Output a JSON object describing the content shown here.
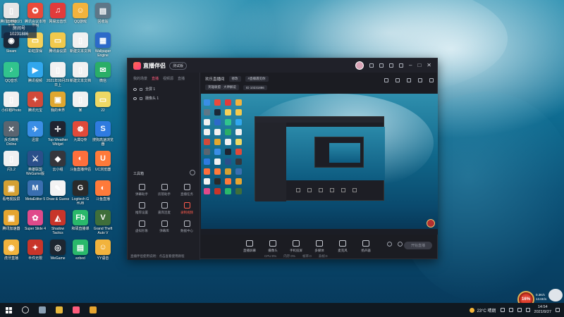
{
  "desktop": {
    "icons": [
      {
        "label": "此电脑",
        "color": "#3a8ee6",
        "glyph": "▣"
      },
      {
        "label": "腾讯会议本地录制",
        "color": "#e94a3a",
        "glyph": "✪"
      },
      {
        "label": "网易云音乐",
        "color": "#e23b3b",
        "glyph": "♫"
      },
      {
        "label": "QQ游戏",
        "color": "#f2b33d",
        "glyph": "☺"
      },
      {
        "label": "回收站",
        "color": "#5e7788",
        "glyph": "▤"
      },
      {
        "label": "Steam",
        "color": "#1b2838",
        "glyph": "◉"
      },
      {
        "label": "彩虹屏保",
        "color": "#f6d15a",
        "glyph": "▭"
      },
      {
        "label": "腾讯会议屏",
        "color": "#f2c94c",
        "glyph": "▭"
      },
      {
        "label": "新建文本文档",
        "color": "#f1f1f1",
        "glyph": "▯"
      },
      {
        "label": "Wallpaper Engine",
        "color": "#2c6ac9",
        "glyph": "▦"
      },
      {
        "label": "QQ音乐",
        "color": "#31c48d",
        "glyph": "♪"
      },
      {
        "label": "腾讯视频",
        "color": "#31a7ee",
        "glyph": "▶"
      },
      {
        "label": "2021年09月29日上",
        "color": "#f1f1f1",
        "glyph": "▯"
      },
      {
        "label": "新建文本文档",
        "color": "#f1f1f1",
        "glyph": "▯"
      },
      {
        "label": "微信",
        "color": "#2aae67",
        "glyph": "✉"
      },
      {
        "label": "小红帽Photo",
        "color": "#f1f1f1",
        "glyph": "▯"
      },
      {
        "label": "腾讯元宝",
        "color": "#d14a3a",
        "glyph": "✦"
      },
      {
        "label": "我的世界",
        "color": "#e0a730",
        "glyph": "▣"
      },
      {
        "label": "某",
        "color": "#f1f1f1",
        "glyph": "▯"
      },
      {
        "label": "22",
        "color": "#eed865",
        "glyph": "▭"
      },
      {
        "label": "反恐精英Online",
        "color": "#5a6570",
        "glyph": "✕"
      },
      {
        "label": "迅雷",
        "color": "#3a8ee6",
        "glyph": "✈"
      },
      {
        "label": "Top Weather Widget",
        "color": "#1f2430",
        "glyph": "✢"
      },
      {
        "label": "九霄Q传",
        "color": "#e04a3a",
        "glyph": "☸"
      },
      {
        "label": "搜狗高速浏览器",
        "color": "#2f7be0",
        "glyph": "S"
      },
      {
        "label": "闪1.2",
        "color": "#f1f1f1",
        "glyph": "▯"
      },
      {
        "label": "英雄联盟WeGame版",
        "color": "#2a4f8a",
        "glyph": "⚔"
      },
      {
        "label": "云小组",
        "color": "#35363c",
        "glyph": "◆"
      },
      {
        "label": "斗鱼直播伴侣",
        "color": "#ff6f3c",
        "glyph": "◐"
      },
      {
        "label": "UC浏览器",
        "color": "#ff7a3a",
        "glyph": "U"
      },
      {
        "label": "看电视投屏",
        "color": "#d4a033",
        "glyph": "▣"
      },
      {
        "label": "MetaEditor 5",
        "color": "#3a6fb0",
        "glyph": "M"
      },
      {
        "label": "Draw & Guess",
        "color": "#f3f3f3",
        "glyph": "✎"
      },
      {
        "label": "Logitech G HUB",
        "color": "#2a2a2a",
        "glyph": "G"
      },
      {
        "label": "斗鱼直播",
        "color": "#ff7a3a",
        "glyph": "◐"
      },
      {
        "label": "腾讯加速器",
        "color": "#e6a530",
        "glyph": "▣"
      },
      {
        "label": "Super Slide 4",
        "color": "#e04a8a",
        "glyph": "✿"
      },
      {
        "label": "Shadow Tactics",
        "color": "#c8352a",
        "glyph": "◭"
      },
      {
        "label": "和硕直播课",
        "color": "#2ab86b",
        "glyph": "Fb"
      },
      {
        "label": "Grand Theft Auto V",
        "color": "#3f6e3a",
        "glyph": "V"
      },
      {
        "label": "虎牙直播",
        "color": "#f2b33d",
        "glyph": "◉"
      },
      {
        "label": "半件无限",
        "color": "#c8352a",
        "glyph": "✦"
      },
      {
        "label": "WeGame",
        "color": "#1d2630",
        "glyph": "◎"
      },
      {
        "label": "ezbed",
        "color": "#2ab86b",
        "glyph": "▤"
      },
      {
        "label": "YY语音",
        "color": "#f2b33d",
        "glyph": "☺"
      },
      {
        "label": "腾讯工作2021年度",
        "color": "#e6e6e6",
        "glyph": "▯"
      }
    ],
    "badge_text": "房间号",
    "badge_number": "10231886"
  },
  "window": {
    "app_name": "直播伴侣",
    "version": "测试版",
    "left_tabs": [
      "我的场景",
      "直播",
      "视频源",
      "直播"
    ],
    "sources": [
      {
        "label": "全屏 1"
      },
      {
        "label": "摄像头 1"
      }
    ],
    "toolbox_title": "工具箱",
    "tools": [
      {
        "label": "弹幕助手",
        "active": false
      },
      {
        "label": "房管助手",
        "active": false
      },
      {
        "label": "直播任务",
        "active": false
      },
      {
        "label": "推荐设置",
        "active": false
      },
      {
        "label": "嘉宾连麦",
        "active": false
      },
      {
        "label": "录制视频",
        "active": true
      },
      {
        "label": "虚拟形象",
        "active": false
      },
      {
        "label": "弹幕库",
        "active": false
      },
      {
        "label": "数据中心",
        "active": false
      }
    ],
    "notice": "直播伴侣使用说明：点击查看使用教程",
    "room_title": "欢乐直播间",
    "room_edit": "修改",
    "room_tag": "#直播遇见你",
    "room_category": "英雄联盟 · 大神解说",
    "room_id": "ID 10231886",
    "controls": [
      {
        "label": "直播屏幕",
        "icon": "screen-icon"
      },
      {
        "label": "摄像头",
        "icon": "camera-icon"
      },
      {
        "label": "手机投屏",
        "icon": "phone-icon"
      },
      {
        "label": "多媒体",
        "icon": "media-icon"
      },
      {
        "label": "麦克风",
        "icon": "mic-icon"
      },
      {
        "label": "扬声器",
        "icon": "speaker-icon"
      }
    ],
    "go_live": "开始直播",
    "status": [
      "CPU:0%",
      "内存:0%",
      "帧率:0",
      "丢帧:0"
    ]
  },
  "taskbar": {
    "weather": "23°C 晴朗",
    "time": "14:54",
    "date": "2021/9/27",
    "cpu_percent": "16",
    "net_up": "0.3K/s",
    "net_down": "13.6K/s"
  }
}
